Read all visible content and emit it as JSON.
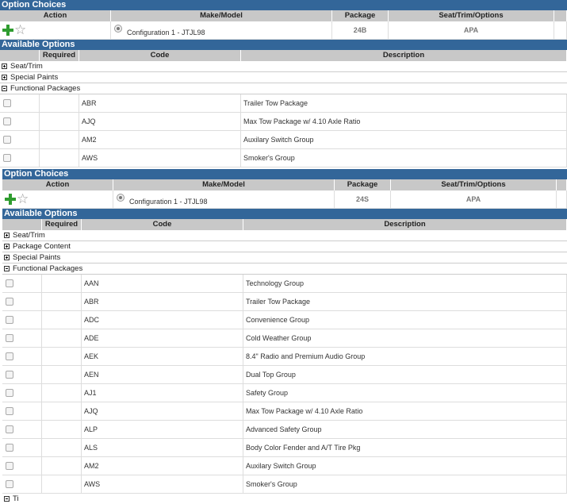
{
  "block1": {
    "option_choices_title": "Option Choices",
    "headers": {
      "action": "Action",
      "make_model": "Make/Model",
      "package": "Package",
      "seat_trim": "Seat/Trim/Options"
    },
    "config": {
      "label": "Configuration 1  -  JTJL98",
      "package": "24B",
      "seat_trim": "APA"
    },
    "available_title": "Available Options",
    "opt_headers": {
      "required": "Required",
      "code": "Code",
      "description": "Description"
    },
    "sections": [
      {
        "label": "Seat/Trim",
        "expanded": false
      },
      {
        "label": "Special Paints",
        "expanded": false
      },
      {
        "label": "Functional Packages",
        "expanded": true
      }
    ],
    "rows": [
      {
        "code": "ABR",
        "description": "Trailer Tow Package"
      },
      {
        "code": "AJQ",
        "description": "Max Tow Package w/ 4.10 Axle Ratio"
      },
      {
        "code": "AM2",
        "description": "Auxilary Switch Group"
      },
      {
        "code": "AWS",
        "description": "Smoker's Group"
      }
    ]
  },
  "block2": {
    "option_choices_title": "Option Choices",
    "headers": {
      "action": "Action",
      "make_model": "Make/Model",
      "package": "Package",
      "seat_trim": "Seat/Trim/Options"
    },
    "config": {
      "label": "Configuration 1  -  JTJL98",
      "package": "24S",
      "seat_trim": "APA"
    },
    "available_title": "Available Options",
    "opt_headers": {
      "required": "Required",
      "code": "Code",
      "description": "Description"
    },
    "sections": [
      {
        "label": "Seat/Trim",
        "expanded": false
      },
      {
        "label": "Package Content",
        "expanded": false
      },
      {
        "label": "Special Paints",
        "expanded": false
      },
      {
        "label": "Functional Packages",
        "expanded": true
      }
    ],
    "rows": [
      {
        "code": "AAN",
        "description": "Technology Group"
      },
      {
        "code": "ABR",
        "description": "Trailer Tow Package"
      },
      {
        "code": "ADC",
        "description": "Convenience Group"
      },
      {
        "code": "ADE",
        "description": "Cold Weather Group"
      },
      {
        "code": "AEK",
        "description": "8.4\" Radio and Premium Audio Group"
      },
      {
        "code": "AEN",
        "description": "Dual Top Group"
      },
      {
        "code": "AJ1",
        "description": "Safety Group"
      },
      {
        "code": "AJQ",
        "description": "Max Tow Package w/ 4.10 Axle Ratio"
      },
      {
        "code": "ALP",
        "description": "Advanced Safety Group"
      },
      {
        "code": "ALS",
        "description": "Body Color Fender and A/T Tire Pkg"
      },
      {
        "code": "AM2",
        "description": "Auxilary Switch Group"
      },
      {
        "code": "AWS",
        "description": "Smoker's Group"
      }
    ],
    "trailing_section": {
      "label": "Ti",
      "expanded": true
    }
  },
  "colors": {
    "bar": "#336699",
    "header_bg": "#c8c8c8",
    "plus": "#2f9c2f"
  }
}
